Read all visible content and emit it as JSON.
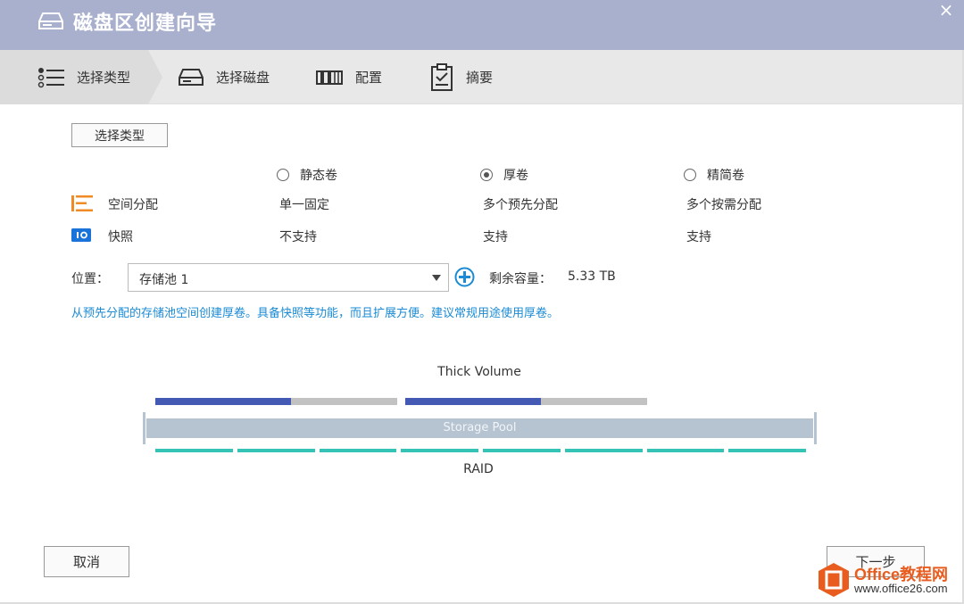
{
  "window": {
    "title": "磁盘区创建向导",
    "close_label": "×"
  },
  "steps": [
    {
      "label": "选择类型",
      "icon": "list-icon",
      "active": true
    },
    {
      "label": "选择磁盘",
      "icon": "disk-icon"
    },
    {
      "label": "配置",
      "icon": "config-icon"
    },
    {
      "label": "摘要",
      "icon": "clipboard-icon"
    }
  ],
  "section_button": "选择类型",
  "volume_types": [
    {
      "label": "静态卷",
      "selected": false
    },
    {
      "label": "厚卷",
      "selected": true
    },
    {
      "label": "精简卷",
      "selected": false
    }
  ],
  "features": [
    {
      "label": "空间分配",
      "icon": "allocation-icon",
      "color": "#f08a24",
      "values": [
        "单一固定",
        "多个预先分配",
        "多个按需分配"
      ]
    },
    {
      "label": "快照",
      "icon": "snapshot-icon",
      "color": "#1a73d9",
      "values": [
        "不支持",
        "支持",
        "支持"
      ]
    }
  ],
  "location": {
    "label": "位置：",
    "value": "存储池 1",
    "remaining_label": "剩余容量：",
    "remaining_value": "5.33 TB"
  },
  "description": "从预先分配的存储池空间创建厚卷。具备快照等功能，而且扩展方便。建议常规用途使用厚卷。",
  "diagram": {
    "volume_label": "Thick Volume",
    "pool_label": "Storage Pool",
    "raid_label": "RAID",
    "volume_blocks": [
      {
        "used_fraction": 0.56
      },
      {
        "used_fraction": 0.56
      }
    ],
    "raid_segments": 8,
    "colors": {
      "used": "#4459b3",
      "free": "#c2c2c2",
      "pool": "#b6c3d1",
      "raid": "#35c3b5"
    }
  },
  "footer": {
    "cancel": "取消",
    "next": "下一步"
  },
  "watermark": {
    "line1": "Office教程网",
    "line2": "www.office26.com"
  }
}
